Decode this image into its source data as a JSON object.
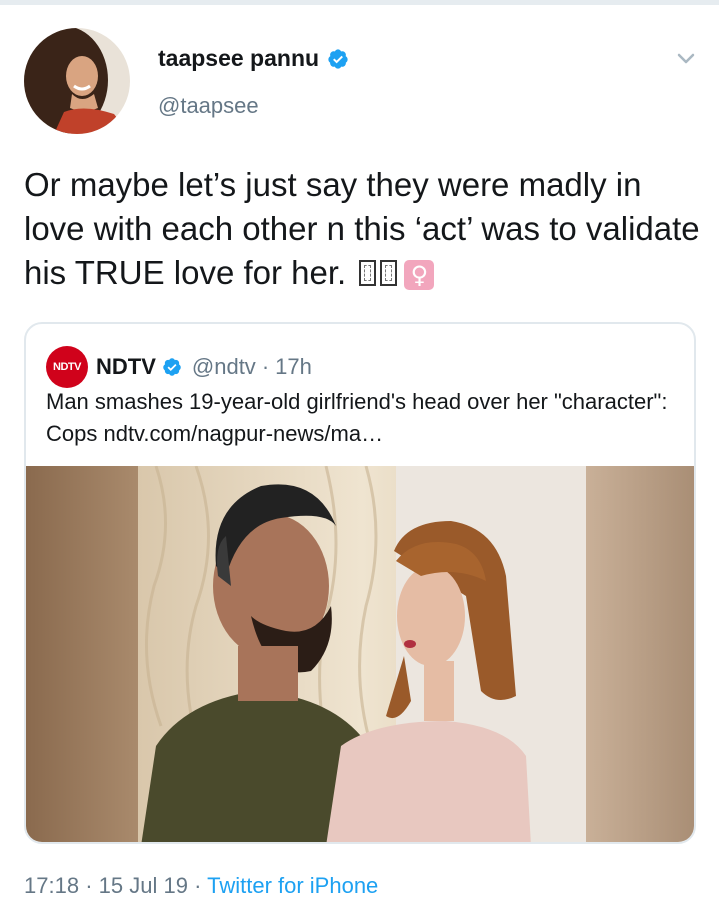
{
  "tweet": {
    "author": {
      "display_name": "taapsee pannu",
      "handle": "@taapsee",
      "verified": true,
      "avatar": "profile-photo"
    },
    "menu_icon": "chevron-down-icon",
    "text": "Or maybe let’s just say they were madly in love with each other n this ‘act’ was to validate his TRUE love for her.",
    "emoji": [
      "unrendered-emoji",
      "unrendered-emoji",
      "female-sign"
    ],
    "female_sign": "♀",
    "quoted_tweet": {
      "logo_text": "NDTV",
      "display_name": "NDTV",
      "verified": true,
      "handle": "@ndtv",
      "separator": "·",
      "time": "17h",
      "text": "Man smashes 19-year-old girlfriend's head over her \"character\": Cops ndtv.com/nagpur-news/ma…",
      "media": "photo-couple"
    },
    "timestamp": {
      "time": "17:18",
      "sep1": "·",
      "date": "15 Jul 19",
      "sep2": "·",
      "source": "Twitter for iPhone"
    }
  },
  "colors": {
    "text": "#14171a",
    "secondary": "#657786",
    "link": "#1da1f2",
    "verified": "#1da1f2",
    "border": "#e1e8ed",
    "ndtv_red": "#d0021b"
  }
}
